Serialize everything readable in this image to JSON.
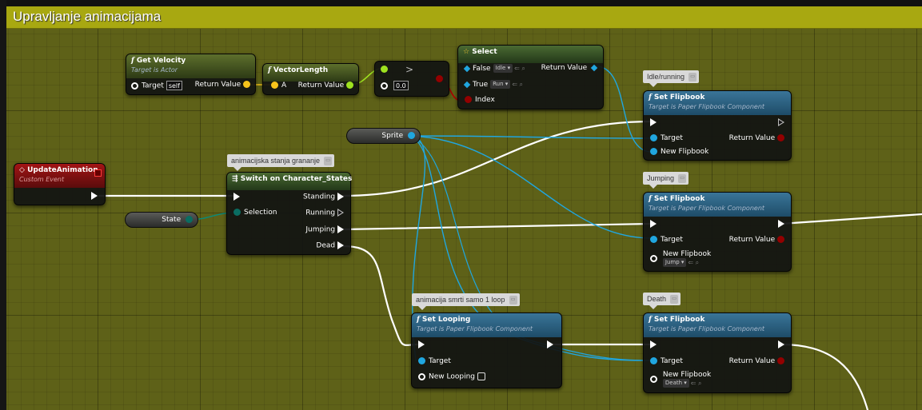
{
  "graph": {
    "comment_title": "Upravljanje animacijama",
    "colors": {
      "comment_header": "#a8a811",
      "exec_wire": "#ffffff",
      "object_wire": "#20a6df",
      "vector_pin": "#f7c41b",
      "float_pin": "#9ee21f",
      "bool_pin": "#930000",
      "enum_pin": "#0a6d62"
    }
  },
  "nodes": {
    "get_velocity": {
      "title": "Get Velocity",
      "subtitle": "Target is Actor",
      "target_label": "Target",
      "target_value": "self",
      "return_label": "Return Value"
    },
    "vector_length": {
      "title": "VectorLength",
      "a_label": "A",
      "return_label": "Return Value"
    },
    "compare": {
      "value": "0.0"
    },
    "select": {
      "title": "Select",
      "false_label": "False",
      "false_value": "Idle",
      "true_label": "True",
      "true_value": "Run",
      "index_label": "Index",
      "return_label": "Return Value"
    },
    "update_animation": {
      "title": "UpdateAnimation",
      "subtitle": "Custom Event"
    },
    "state_var": {
      "label": "State"
    },
    "sprite_var": {
      "label": "Sprite"
    },
    "switch": {
      "comment": "animacijska stanja grananje",
      "title": "Switch on Character_States",
      "selection_label": "Selection",
      "standing_label": "Standing",
      "running_label": "Running",
      "jumping_label": "Jumping",
      "dead_label": "Dead"
    },
    "set_flipbook_idle": {
      "comment": "Idle/running",
      "title": "Set Flipbook",
      "subtitle": "Target is Paper Flipbook Component",
      "target_label": "Target",
      "return_label": "Return Value",
      "flipbook_label": "New Flipbook"
    },
    "set_flipbook_jump": {
      "comment": "Jumping",
      "title": "Set Flipbook",
      "subtitle": "Target is Paper Flipbook Component",
      "target_label": "Target",
      "return_label": "Return Value",
      "flipbook_label": "New Flipbook",
      "flipbook_value": "Jump"
    },
    "set_looping": {
      "comment": "animacija smrti samo 1 loop",
      "title": "Set Looping",
      "subtitle": "Target is Paper Flipbook Component",
      "target_label": "Target",
      "looping_label": "New Looping"
    },
    "set_flipbook_death": {
      "comment": "Death",
      "title": "Set Flipbook",
      "subtitle": "Target is Paper Flipbook Component",
      "target_label": "Target",
      "return_label": "Return Value",
      "flipbook_label": "New Flipbook",
      "flipbook_value": "Death"
    }
  }
}
